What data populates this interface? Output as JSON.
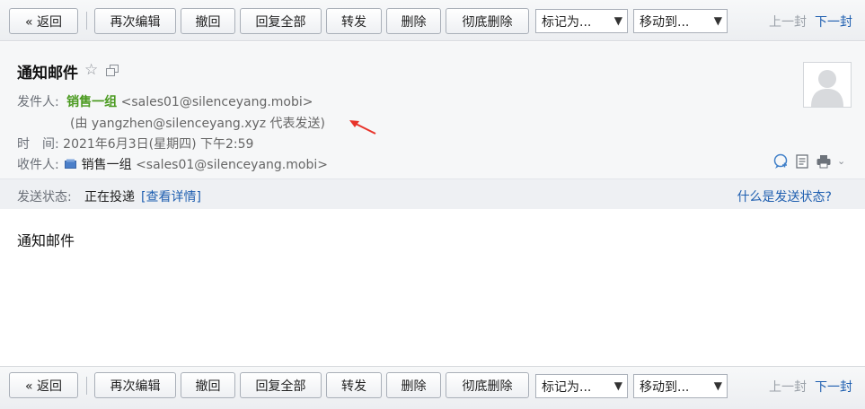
{
  "toolbar": {
    "back_label": "« 返回",
    "reedit_label": "再次编辑",
    "recall_label": "撤回",
    "reply_all_label": "回复全部",
    "forward_label": "转发",
    "delete_label": "删除",
    "perm_delete_label": "彻底删除",
    "mark_as_label": "标记为...",
    "move_to_label": "移动到...",
    "prev_label": "上一封",
    "next_label": "下一封"
  },
  "header": {
    "subject": "通知邮件",
    "from_label": "发件人:",
    "from_name": "销售一组",
    "from_address": "<sales01@silenceyang.mobi>",
    "on_behalf": "(由 yangzhen@silenceyang.xyz 代表发送)",
    "time_label": "时　间:",
    "time_value": "2021年6月3日(星期四) 下午2:59",
    "to_label": "收件人:",
    "to_name": "销售一组",
    "to_address": "<sales01@silenceyang.mobi>"
  },
  "status": {
    "label": "发送状态:",
    "value": "正在投递",
    "details_link": "[查看详情]",
    "help_link": "什么是发送状态?"
  },
  "body": {
    "text": "通知邮件"
  },
  "colors": {
    "sender_green": "#4a9a1f",
    "link_blue": "#1f5fb0",
    "arrow_red": "#e8332a"
  },
  "icons": [
    "star-icon",
    "popout-icon",
    "contact-card-icon",
    "avatar-placeholder",
    "chat-reply-icon",
    "note-icon",
    "print-icon",
    "more-chevron-icon",
    "red-annotation-arrow"
  ]
}
